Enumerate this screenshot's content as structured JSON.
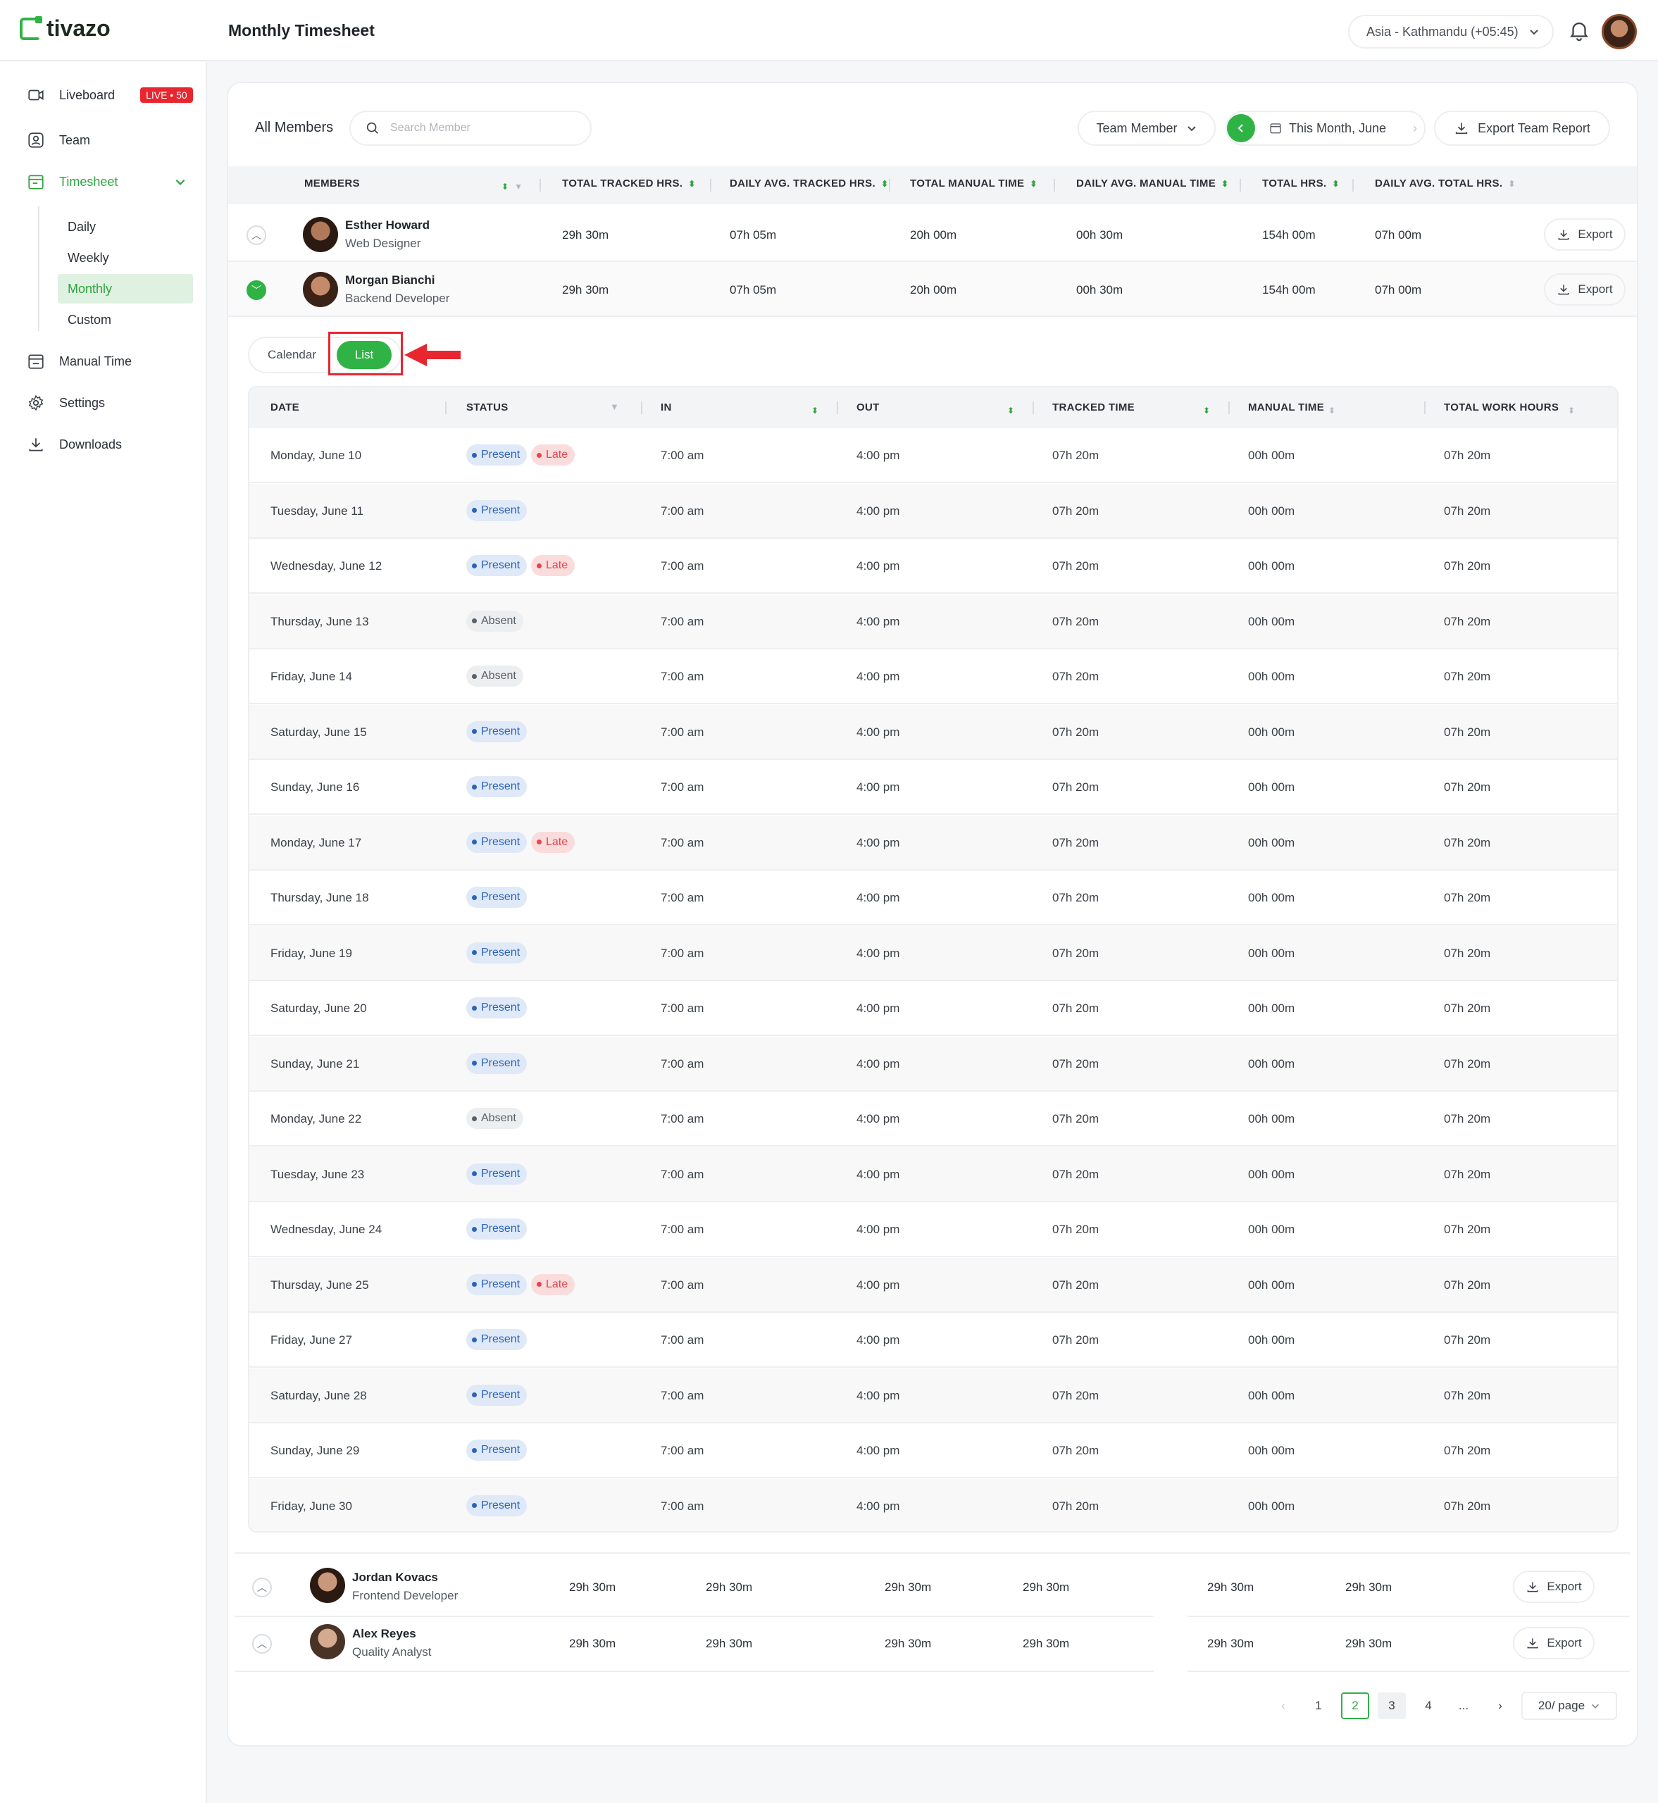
{
  "app": {
    "name": "tivazo",
    "page_title": "Monthly Timesheet",
    "timezone": "Asia - Kathmandu (+05:45)"
  },
  "sidebar": {
    "liveboard": "Liveboard",
    "live_badge": "LIVE • 50",
    "team": "Team",
    "timesheet": "Timesheet",
    "sub": [
      "Daily",
      "Weekly",
      "Monthly",
      "Custom"
    ],
    "manual_time": "Manual Time",
    "settings": "Settings",
    "downloads": "Downloads"
  },
  "toolbar": {
    "title": "All Members",
    "search_placeholder": "Search Member",
    "team_member": "Team Member",
    "period": "This Month, June",
    "export_team": "Export Team Report"
  },
  "members_header": [
    "MEMBERS",
    "TOTAL TRACKED HRS.",
    "DAILY AVG. TRACKED HRS.",
    "TOTAL MANUAL TIME",
    "DAILY AVG.  MANUAL TIME",
    "TOTAL HRS.",
    "DAILY AVG. TOTAL HRS."
  ],
  "members": [
    {
      "name": "Esther Howard",
      "role": "Web Designer",
      "values": [
        "29h 30m",
        "07h 05m",
        "20h 00m",
        "00h 30m",
        "154h 00m",
        "07h 00m"
      ],
      "export": "Export"
    },
    {
      "name": "Morgan Bianchi",
      "role": "Backend Developer",
      "values": [
        "29h 30m",
        "07h 05m",
        "20h 00m",
        "00h 30m",
        "154h 00m",
        "07h 00m"
      ],
      "export": "Export"
    }
  ],
  "view_toggle": {
    "calendar": "Calendar",
    "list": "List"
  },
  "detail_header": [
    "DATE",
    "STATUS",
    "IN",
    "OUT",
    "TRACKED TIME",
    "MANUAL TIME",
    "TOTAL WORK HOURS"
  ],
  "detail_rows": [
    {
      "date": "Monday, June 10",
      "status": [
        "Present",
        "Late"
      ],
      "in": "7:00 am",
      "out": "4:00 pm",
      "tracked": "07h 20m",
      "manual": "00h 00m",
      "total": "07h 20m"
    },
    {
      "date": "Tuesday, June 11",
      "status": [
        "Present"
      ],
      "in": "7:00 am",
      "out": "4:00 pm",
      "tracked": "07h 20m",
      "manual": "00h 00m",
      "total": "07h 20m"
    },
    {
      "date": "Wednesday, June 12",
      "status": [
        "Present",
        "Late"
      ],
      "in": "7:00 am",
      "out": "4:00 pm",
      "tracked": "07h 20m",
      "manual": "00h 00m",
      "total": "07h 20m"
    },
    {
      "date": "Thursday, June 13",
      "status": [
        "Absent"
      ],
      "in": "7:00 am",
      "out": "4:00 pm",
      "tracked": "07h 20m",
      "manual": "00h 00m",
      "total": "07h 20m"
    },
    {
      "date": "Friday, June 14",
      "status": [
        "Absent"
      ],
      "in": "7:00 am",
      "out": "4:00 pm",
      "tracked": "07h 20m",
      "manual": "00h 00m",
      "total": "07h 20m"
    },
    {
      "date": "Saturday, June 15",
      "status": [
        "Present"
      ],
      "in": "7:00 am",
      "out": "4:00 pm",
      "tracked": "07h 20m",
      "manual": "00h 00m",
      "total": "07h 20m"
    },
    {
      "date": "Sunday, June 16",
      "status": [
        "Present"
      ],
      "in": "7:00 am",
      "out": "4:00 pm",
      "tracked": "07h 20m",
      "manual": "00h 00m",
      "total": "07h 20m"
    },
    {
      "date": "Monday, June 17",
      "status": [
        "Present",
        "Late"
      ],
      "in": "7:00 am",
      "out": "4:00 pm",
      "tracked": "07h 20m",
      "manual": "00h 00m",
      "total": "07h 20m"
    },
    {
      "date": "Thursday, June 18",
      "status": [
        "Present"
      ],
      "in": "7:00 am",
      "out": "4:00 pm",
      "tracked": "07h 20m",
      "manual": "00h 00m",
      "total": "07h 20m"
    },
    {
      "date": "Friday, June 19",
      "status": [
        "Present"
      ],
      "in": "7:00 am",
      "out": "4:00 pm",
      "tracked": "07h 20m",
      "manual": "00h 00m",
      "total": "07h 20m"
    },
    {
      "date": "Saturday, June 20",
      "status": [
        "Present"
      ],
      "in": "7:00 am",
      "out": "4:00 pm",
      "tracked": "07h 20m",
      "manual": "00h 00m",
      "total": "07h 20m"
    },
    {
      "date": "Sunday, June 21",
      "status": [
        "Present"
      ],
      "in": "7:00 am",
      "out": "4:00 pm",
      "tracked": "07h 20m",
      "manual": "00h 00m",
      "total": "07h 20m"
    },
    {
      "date": "Monday, June 22",
      "status": [
        "Absent"
      ],
      "in": "7:00 am",
      "out": "4:00 pm",
      "tracked": "07h 20m",
      "manual": "00h 00m",
      "total": "07h 20m"
    },
    {
      "date": "Tuesday, June 23",
      "status": [
        "Present"
      ],
      "in": "7:00 am",
      "out": "4:00 pm",
      "tracked": "07h 20m",
      "manual": "00h 00m",
      "total": "07h 20m"
    },
    {
      "date": "Wednesday, June 24",
      "status": [
        "Present"
      ],
      "in": "7:00 am",
      "out": "4:00 pm",
      "tracked": "07h 20m",
      "manual": "00h 00m",
      "total": "07h 20m"
    },
    {
      "date": "Thursday, June 25",
      "status": [
        "Present",
        "Late"
      ],
      "in": "7:00 am",
      "out": "4:00 pm",
      "tracked": "07h 20m",
      "manual": "00h 00m",
      "total": "07h 20m"
    },
    {
      "date": "Friday, June 27",
      "status": [
        "Present"
      ],
      "in": "7:00 am",
      "out": "4:00 pm",
      "tracked": "07h 20m",
      "manual": "00h 00m",
      "total": "07h 20m"
    },
    {
      "date": "Saturday, June 28",
      "status": [
        "Present"
      ],
      "in": "7:00 am",
      "out": "4:00 pm",
      "tracked": "07h 20m",
      "manual": "00h 00m",
      "total": "07h 20m"
    },
    {
      "date": "Sunday, June 29",
      "status": [
        "Present"
      ],
      "in": "7:00 am",
      "out": "4:00 pm",
      "tracked": "07h 20m",
      "manual": "00h 00m",
      "total": "07h 20m"
    },
    {
      "date": "Friday, June 30",
      "status": [
        "Present"
      ],
      "in": "7:00 am",
      "out": "4:00 pm",
      "tracked": "07h 20m",
      "manual": "00h 00m",
      "total": "07h 20m"
    }
  ],
  "lower_members": [
    {
      "name": "Jordan Kovacs",
      "role": "Frontend Developer",
      "values": [
        "29h 30m",
        "29h 30m",
        "29h 30m",
        "29h 30m",
        "29h 30m",
        "29h 30m"
      ],
      "export": "Export"
    },
    {
      "name": "Alex Reyes",
      "role": "Quality Analyst",
      "values": [
        "29h 30m",
        "29h 30m",
        "29h 30m",
        "29h 30m",
        "29h 30m",
        "29h 30m"
      ],
      "export": "Export"
    }
  ],
  "pagination": {
    "pages": [
      "1",
      "2",
      "3",
      "4",
      "..."
    ],
    "current": "2",
    "per_page": "20/ page"
  },
  "colors": {
    "accent": "#2fb344",
    "present": "#2c63b8",
    "late": "#e0484e",
    "live": "#e8262f"
  }
}
